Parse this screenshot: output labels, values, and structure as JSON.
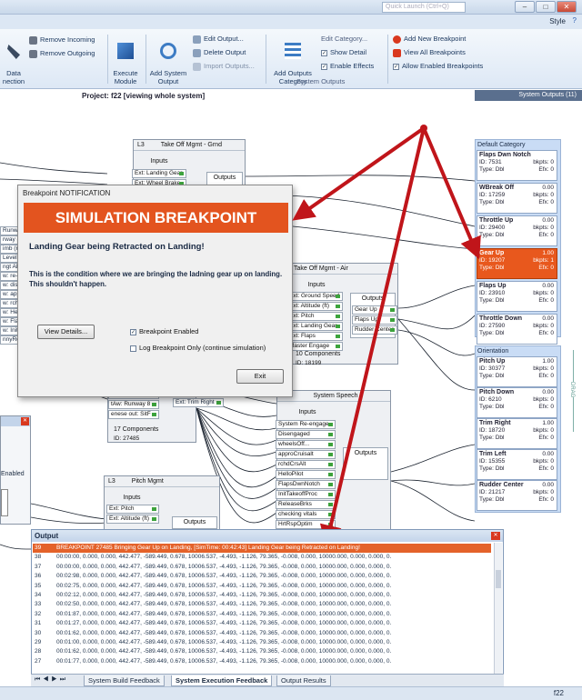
{
  "window": {
    "search_placeholder": "Quick Launch (Ctrl+Q)",
    "style_label": "Style"
  },
  "ribbon": {
    "data_connection": "Data\nnection",
    "remove_incoming": "Remove Incoming",
    "remove_outgoing": "Remove Outgoing",
    "execute_module": "Execute\nModule",
    "add_system_output": "Add System\nOutput",
    "edit_output": "Edit Output...",
    "delete_output": "Delete Output",
    "import_outputs": "Import Outputs...",
    "add_outputs_category": "Add Outputs\nCategory",
    "edit_category": "Edit Category...",
    "show_detail": "Show Detail",
    "enable_effects": "Enable Effects",
    "group_system_outputs": "System Outputs",
    "add_new_breakpoint": "Add New Breakpoint",
    "view_all_breakpoints": "View All Breakpoints",
    "allow_enabled_breakpoints": "Allow Enabled Breakpoints"
  },
  "canvas": {
    "project_title": "Project: f22 [viewing whole system]",
    "nodes": {
      "takeoff_grnd": {
        "level": "L3",
        "title": "Take Off Mgmt - Grnd",
        "inputs_label": "Inputs",
        "outputs_label": "Outputs",
        "ports": [
          "Ext: Landing Gear",
          "Ext: Wheel Brake"
        ]
      },
      "takeoff_air": {
        "title": "Take Off Mgmt - Air",
        "inputs_label": "Inputs",
        "outputs_label": "Outputs",
        "ports": [
          "Ext: Ground Speed",
          "Ext: Altitude (ft)",
          "Ext: Pitch",
          "Ext: Landing Gear",
          "Ext: Flaps",
          "Master Engage"
        ],
        "outputs": [
          "Gear Up",
          "Flaps Up",
          "Rudder Center"
        ],
        "components": "10 Components",
        "id": "ID: 18199"
      },
      "middle": {
        "ports_left": [
          "HDM Master En",
          "tAw: Runway 8",
          "enese out: SitF"
        ],
        "port_right": "Ext: Trim Right",
        "components": "17 Components",
        "id": "ID: 27485"
      },
      "speech": {
        "title": "System Speech",
        "inputs_label": "Inputs",
        "outputs_label": "Outputs",
        "ports": [
          "System Re-engage",
          "Disengaged",
          "wheelsOff...",
          "approCruisalt",
          "rchdCrsAlt",
          "HelloPilot",
          "FlapsDwnNotch",
          "InitTakeoffProc",
          "ReleaseBrks",
          "checking vitals",
          "HrtRspOptim"
        ]
      },
      "pitch": {
        "level": "L3",
        "title": "Pitch Mgmt",
        "inputs_label": "Inputs",
        "outputs_label": "Outputs",
        "ports": [
          "Ext: Pitch",
          "Ext: Altitude (ft)"
        ]
      },
      "left_fragments": [
        "Runway",
        "rway (",
        "imb (ra",
        "Level",
        "ngt Alt",
        "w: re-e",
        "w: dise",
        "w: app",
        "w: rch",
        "w: Hell",
        "w: Fla",
        "w: Init",
        "nnyRe"
      ],
      "left_panel_text": "Enabled"
    }
  },
  "dialog": {
    "title": "Breakpoint NOTIFICATION",
    "banner": "SIMULATION BREAKPOINT",
    "heading": "Landing Gear being Retracted on Landing!",
    "description": "This is the condition where we are bringing the ladning gear up on landing. This shouldn't happen.",
    "view_details": "View Details...",
    "breakpoint_enabled": "Breakpoint Enabled",
    "log_only": "Log Breakpoint Only (continue simulation)",
    "exit": "Exit"
  },
  "sidebar": {
    "title": "System Outputs (11)",
    "default_category": "Default Category",
    "orientation_category": "Orientation",
    "drag_label": "DRAG",
    "default_cards": [
      {
        "name": "Flaps Dwn Notch",
        "id": "ID: 7531",
        "type": "Type: Dbl",
        "val": "",
        "bkpts": "bkpts: 0",
        "efx": "Efx: 0"
      },
      {
        "name": "WBreak Off",
        "id": "ID: 17259",
        "type": "Type: Dbl",
        "val": "0.00",
        "bkpts": "bkpts: 0",
        "efx": "Efx: 0"
      },
      {
        "name": "Throttle Up",
        "id": "ID: 29400",
        "type": "Type: Dbl",
        "val": "0.00",
        "bkpts": "bkpts: 0",
        "efx": "Efx: 0"
      },
      {
        "name": "Gear Up",
        "id": "ID: 19207",
        "type": "Type: Dbl",
        "val": "1.00",
        "bkpts": "bkpts: 1",
        "efx": "Efx: 0"
      },
      {
        "name": "Flaps Up",
        "id": "ID: 23910",
        "type": "Type: Dbl",
        "val": "0.00",
        "bkpts": "bkpts: 0",
        "efx": "Efx: 0"
      },
      {
        "name": "Throttle Down",
        "id": "ID: 27590",
        "type": "Type: Dbl",
        "val": "0.00",
        "bkpts": "bkpts: 0",
        "efx": "Efx: 0"
      }
    ],
    "orientation_cards": [
      {
        "name": "Pitch Up",
        "id": "ID: 30377",
        "type": "Type: Dbl",
        "val": "1.00",
        "bkpts": "bkpts: 0",
        "efx": "Efx: 0"
      },
      {
        "name": "Pitch Down",
        "id": "ID: 6210",
        "type": "Type: Dbl",
        "val": "0.00",
        "bkpts": "bkpts: 0",
        "efx": "Efx: 0"
      },
      {
        "name": "Trim Right",
        "id": "ID: 18720",
        "type": "Type: Dbl",
        "val": "1.00",
        "bkpts": "bkpts: 0",
        "efx": "Efx: 0"
      },
      {
        "name": "Trim Left",
        "id": "ID: 15355",
        "type": "Type: Dbl",
        "val": "0.00",
        "bkpts": "bkpts: 0",
        "efx": "Efx: 0"
      },
      {
        "name": "Rudder Center",
        "id": "ID: 21217",
        "type": "Type: Dbl",
        "val": "0.00",
        "bkpts": "bkpts: 0",
        "efx": "Efx: 0"
      }
    ]
  },
  "output": {
    "title": "Output",
    "rows": [
      {
        "n": "39",
        "text": "BREAKPOINT 27485 Bringing Gear Up on Landing, [SimTime: 00:42:43] Landing Gear being Retracted on Landing!"
      },
      {
        "n": "38",
        "text": "00:00:00, 0.000, 0.000, 442.477, -589.449, 0.678, 10006.537, -4.493, -1.126, 79.365, -0.008, 0.000, 10000.000, 0.000, 0.000, 0."
      },
      {
        "n": "37",
        "text": "00:00:00, 0.000, 0.000, 442.477, -589.449, 0.678, 10006.537, -4.493, -1.126, 79.365, -0.008, 0.000, 10000.000, 0.000, 0.000, 0."
      },
      {
        "n": "36",
        "text": "00:02:98, 0.000, 0.000, 442.477, -589.449, 0.678, 10006.537, -4.493, -1.126, 79.365, -0.008, 0.000, 10000.000, 0.000, 0.000, 0."
      },
      {
        "n": "35",
        "text": "00:02:75, 0.000, 0.000, 442.477, -589.449, 0.678, 10006.537, -4.493, -1.126, 79.365, -0.008, 0.000, 10000.000, 0.000, 0.000, 0."
      },
      {
        "n": "34",
        "text": "00:02:12, 0.000, 0.000, 442.477, -589.449, 0.678, 10006.537, -4.493, -1.126, 79.365, -0.008, 0.000, 10000.000, 0.000, 0.000, 0."
      },
      {
        "n": "33",
        "text": "00:02:50, 0.000, 0.000, 442.477, -589.449, 0.678, 10006.537, -4.493, -1.126, 79.365, -0.008, 0.000, 10000.000, 0.000, 0.000, 0."
      },
      {
        "n": "32",
        "text": "00:01:87, 0.000, 0.000, 442.477, -589.449, 0.678, 10006.537, -4.493, -1.126, 79.365, -0.008, 0.000, 10000.000, 0.000, 0.000, 0."
      },
      {
        "n": "31",
        "text": "00:01:27, 0.000, 0.000, 442.477, -589.449, 0.678, 10006.537, -4.493, -1.126, 79.365, -0.008, 0.000, 10000.000, 0.000, 0.000, 0."
      },
      {
        "n": "30",
        "text": "00:01:62, 0.000, 0.000, 442.477, -589.449, 0.678, 10006.537, -4.493, -1.126, 79.365, -0.008, 0.000, 10000.000, 0.000, 0.000, 0."
      },
      {
        "n": "29",
        "text": "00:01:00, 0.000, 0.000, 442.477, -589.449, 0.678, 10006.537, -4.493, -1.126, 79.365, -0.008, 0.000, 10000.000, 0.000, 0.000, 0."
      },
      {
        "n": "28",
        "text": "00:01:62, 0.000, 0.000, 442.477, -589.449, 0.678, 10006.537, -4.493, -1.126, 79.365, -0.008, 0.000, 10000.000, 0.000, 0.000, 0."
      },
      {
        "n": "27",
        "text": "00:01:77, 0.000, 0.000, 442.477, -589.449, 0.678, 10006.537, -4.493, -1.126, 79.365, -0.008, 0.000, 10000.000, 0.000, 0.000, 0."
      }
    ],
    "tabs": [
      "System Build Feedback",
      "System Execution Feedback",
      "Output Results"
    ]
  },
  "status": {
    "right_text": "f22"
  },
  "colors": {
    "accent_orange": "#e3541f",
    "arrow_red": "#c0151a",
    "sidebar_header": "#5a6f8e"
  }
}
